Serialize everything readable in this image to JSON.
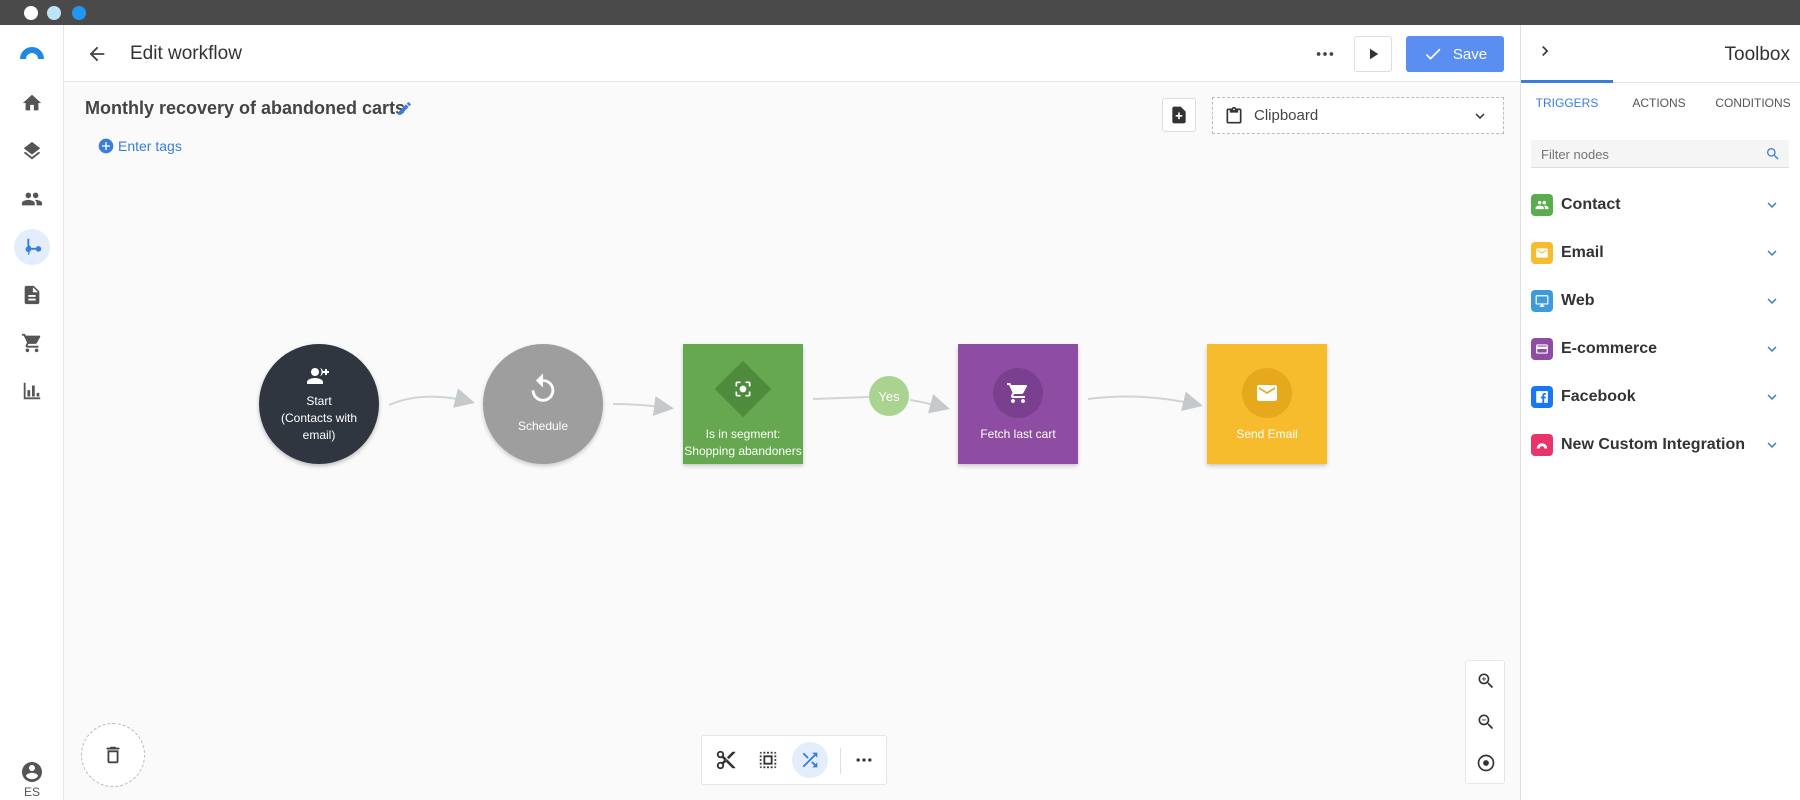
{
  "window": {
    "dots": [
      "#ffffff",
      "#bfe3f7",
      "#2196f3"
    ]
  },
  "nav": {
    "items": [
      {
        "name": "home-icon"
      },
      {
        "name": "layers-icon"
      },
      {
        "name": "contacts-icon"
      },
      {
        "name": "workflow-icon",
        "active": true
      },
      {
        "name": "document-icon"
      },
      {
        "name": "cart-icon"
      },
      {
        "name": "chart-icon"
      }
    ],
    "language": "ES"
  },
  "header": {
    "title": "Edit workflow",
    "save_label": "Save"
  },
  "workflow": {
    "name": "Monthly recovery of abandoned carts",
    "tags_placeholder": "Enter tags",
    "clipboard_label": "Clipboard"
  },
  "nodes": [
    {
      "id": "start",
      "label": "Start\n(Contacts with email)",
      "line1": "Start",
      "line2": "(Contacts with",
      "line3": "email)",
      "color": "#2f3640"
    },
    {
      "id": "schedule",
      "label": "Schedule",
      "color": "#9e9e9e"
    },
    {
      "id": "segment",
      "line1": "Is in segment:",
      "line2": "Shopping abandoners",
      "color": "#66a84f"
    },
    {
      "id": "fetch",
      "label": "Fetch last cart",
      "color": "#8e4da3"
    },
    {
      "id": "email",
      "label": "Send Email",
      "color": "#f6bc2e"
    }
  ],
  "edge_labels": {
    "yes": "Yes"
  },
  "toolbox": {
    "title": "Toolbox",
    "tabs": [
      "TRIGGERS",
      "ACTIONS",
      "CONDITIONS"
    ],
    "active_tab": "TRIGGERS",
    "filter_placeholder": "Filter nodes",
    "categories": [
      {
        "label": "Contact",
        "color": "#5aad4e",
        "icon": "contacts-icon"
      },
      {
        "label": "Email",
        "color": "#f6bc2e",
        "icon": "mail-icon"
      },
      {
        "label": "Web",
        "color": "#3f9ad9",
        "icon": "monitor-icon"
      },
      {
        "label": "E-commerce",
        "color": "#8e4da3",
        "icon": "card-icon"
      },
      {
        "label": "Facebook",
        "color": "#1877f2",
        "icon": "facebook-icon"
      },
      {
        "label": "New Custom Integration",
        "color": "#e8346a",
        "icon": "integration-icon"
      }
    ]
  },
  "colors": {
    "accent": "#3b7ddd",
    "save": "#5a8ef0"
  }
}
